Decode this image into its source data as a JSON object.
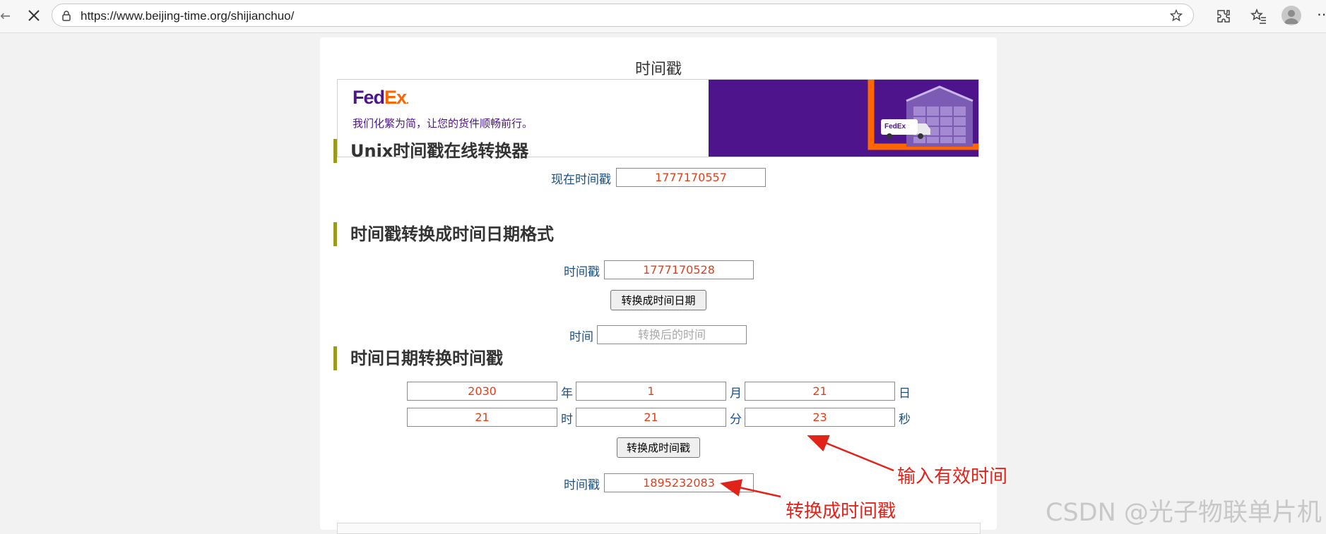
{
  "browser": {
    "url": "https://www.beijing-time.org/shijianchuo/"
  },
  "page": {
    "title": "时间戳"
  },
  "ad": {
    "brand_fed": "Fed",
    "brand_ex": "Ex",
    "tagline": "我们化繁为简，让您的货件顺畅前行。",
    "van_logo": "FedEx"
  },
  "current": {
    "heading": "Unix时间戳在线转换器",
    "label": "现在时间戳",
    "value": "1777170557"
  },
  "to_date": {
    "heading": "时间戳转换成时间日期格式",
    "ts_label": "时间戳",
    "ts_value": "1777170528",
    "button": "转换成时间日期",
    "result_label": "时间",
    "result_placeholder": "转换后的时间"
  },
  "to_ts": {
    "heading": "时间日期转换时间戳",
    "year": "2030",
    "year_unit": "年",
    "month": "1",
    "month_unit": "月",
    "day": "21",
    "day_unit": "日",
    "hour": "21",
    "hour_unit": "时",
    "minute": "21",
    "minute_unit": "分",
    "second": "23",
    "second_unit": "秒",
    "button": "转换成时间戳",
    "result_label": "时间戳",
    "result_value": "1895232083"
  },
  "annotations": {
    "input_note": "输入有效时间",
    "convert_note": "转换成时间戳"
  },
  "watermark": "CSDN @光子物联单片机",
  "colors": {
    "fedex_purple": "#4d148c",
    "fedex_orange": "#ff6600",
    "label_blue": "#1a4f8a",
    "value_red": "#e0401a",
    "annotation_red": "#e2231a",
    "heading_bar": "#9a9a1e"
  }
}
